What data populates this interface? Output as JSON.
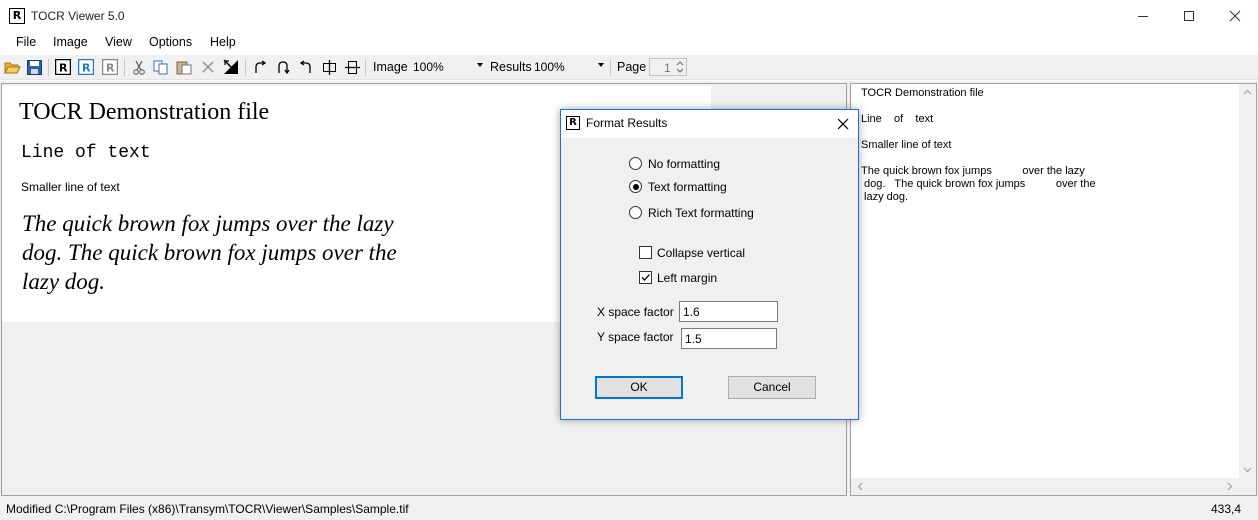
{
  "window": {
    "title": "TOCR Viewer 5.0",
    "app_icon_letter": "R"
  },
  "menu": {
    "items": [
      "File",
      "Image",
      "View",
      "Options",
      "Help"
    ]
  },
  "toolbar": {
    "image_label": "Image",
    "image_zoom": "100%",
    "results_label": "Results",
    "results_zoom": "100%",
    "page_label": "Page",
    "page_value": "1"
  },
  "document": {
    "title": "TOCR Demonstration file",
    "line2": "Line of text",
    "line3": "Smaller line of text",
    "para_lines": [
      "The quick brown fox jumps over the lazy",
      "dog.  The quick brown fox jumps over the",
      "lazy dog."
    ]
  },
  "results": {
    "lines": [
      "TOCR Demonstration file",
      "Line    of    text",
      "Smaller line of text",
      "The quick brown fox jumps          over the lazy",
      " dog.   The quick brown fox jumps          over the",
      " lazy dog."
    ]
  },
  "dialog": {
    "title": "Format Results",
    "options": [
      "No formatting",
      "Text formatting",
      "Rich Text formatting"
    ],
    "selected_option": 1,
    "checks": [
      {
        "label": "Collapse vertical",
        "checked": false
      },
      {
        "label": "Left margin",
        "checked": true
      }
    ],
    "x_space_label": "X space factor",
    "x_space_value": "1.6",
    "y_space_label": "Y space factor",
    "y_space_value": "1.5",
    "ok_label": "OK",
    "cancel_label": "Cancel"
  },
  "status": {
    "text": "Modified C:\\Program Files (x86)\\Transym\\TOCR\\Viewer\\Samples\\Sample.tif",
    "coords": "433,4"
  },
  "colors": {
    "accent": "#0078d7",
    "window_bg": "#f0f0f0",
    "dialog_border": "#1e6fd9"
  }
}
